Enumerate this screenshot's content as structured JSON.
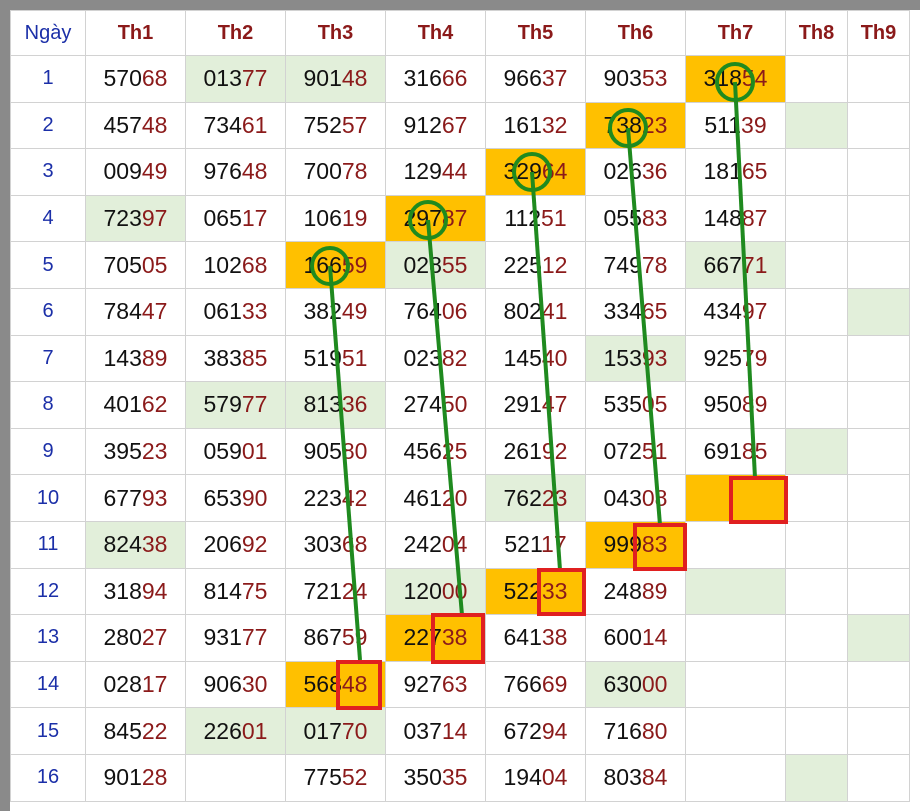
{
  "columns": [
    "Ngày",
    "Th1",
    "Th2",
    "Th3",
    "Th4",
    "Th5",
    "Th6",
    "Th7",
    "Th8",
    "Th9"
  ],
  "rows": [
    {
      "day": "1",
      "cells": [
        [
          "570",
          "68",
          "n"
        ],
        [
          "013",
          "77",
          "g"
        ],
        [
          "901",
          "48",
          "g"
        ],
        [
          "316",
          "66",
          "n"
        ],
        [
          "966",
          "37",
          "n"
        ],
        [
          "903",
          "53",
          "n"
        ],
        [
          "318",
          "54",
          "o"
        ],
        [
          "",
          "",
          "n"
        ],
        [
          "",
          "",
          "n"
        ]
      ]
    },
    {
      "day": "2",
      "cells": [
        [
          "457",
          "48",
          "n"
        ],
        [
          "734",
          "61",
          "n"
        ],
        [
          "752",
          "57",
          "n"
        ],
        [
          "912",
          "67",
          "n"
        ],
        [
          "161",
          "32",
          "n"
        ],
        [
          "738",
          "23",
          "o"
        ],
        [
          "511",
          "39",
          "n"
        ],
        [
          "",
          "",
          "g"
        ],
        [
          "",
          "",
          "n"
        ]
      ]
    },
    {
      "day": "3",
      "cells": [
        [
          "009",
          "49",
          "n"
        ],
        [
          "976",
          "48",
          "n"
        ],
        [
          "700",
          "78",
          "n"
        ],
        [
          "129",
          "44",
          "n"
        ],
        [
          "329",
          "64",
          "o"
        ],
        [
          "026",
          "36",
          "n"
        ],
        [
          "181",
          "65",
          "n"
        ],
        [
          "",
          "",
          "n"
        ],
        [
          "",
          "",
          "n"
        ]
      ]
    },
    {
      "day": "4",
      "cells": [
        [
          "723",
          "97",
          "g"
        ],
        [
          "065",
          "17",
          "n"
        ],
        [
          "106",
          "19",
          "n"
        ],
        [
          "297",
          "87",
          "o"
        ],
        [
          "112",
          "51",
          "n"
        ],
        [
          "055",
          "83",
          "n"
        ],
        [
          "148",
          "87",
          "n"
        ],
        [
          "",
          "",
          "n"
        ],
        [
          "",
          "",
          "n"
        ]
      ]
    },
    {
      "day": "5",
      "cells": [
        [
          "705",
          "05",
          "n"
        ],
        [
          "102",
          "68",
          "n"
        ],
        [
          "166",
          "59",
          "o"
        ],
        [
          "028",
          "55",
          "g"
        ],
        [
          "225",
          "12",
          "n"
        ],
        [
          "749",
          "78",
          "n"
        ],
        [
          "667",
          "71",
          "g"
        ],
        [
          "",
          "",
          "n"
        ],
        [
          "",
          "",
          "n"
        ]
      ]
    },
    {
      "day": "6",
      "cells": [
        [
          "784",
          "47",
          "n"
        ],
        [
          "061",
          "33",
          "n"
        ],
        [
          "382",
          "49",
          "n"
        ],
        [
          "764",
          "06",
          "n"
        ],
        [
          "802",
          "41",
          "n"
        ],
        [
          "334",
          "65",
          "n"
        ],
        [
          "434",
          "97",
          "n"
        ],
        [
          "",
          "",
          "n"
        ],
        [
          "",
          "",
          "g"
        ]
      ]
    },
    {
      "day": "7",
      "cells": [
        [
          "143",
          "89",
          "n"
        ],
        [
          "383",
          "85",
          "n"
        ],
        [
          "519",
          "51",
          "n"
        ],
        [
          "023",
          "82",
          "n"
        ],
        [
          "145",
          "40",
          "n"
        ],
        [
          "153",
          "93",
          "g"
        ],
        [
          "925",
          "79",
          "n"
        ],
        [
          "",
          "",
          "n"
        ],
        [
          "",
          "",
          "n"
        ]
      ]
    },
    {
      "day": "8",
      "cells": [
        [
          "401",
          "62",
          "n"
        ],
        [
          "579",
          "77",
          "g"
        ],
        [
          "813",
          "36",
          "g"
        ],
        [
          "274",
          "50",
          "n"
        ],
        [
          "291",
          "47",
          "n"
        ],
        [
          "535",
          "05",
          "n"
        ],
        [
          "950",
          "89",
          "n"
        ],
        [
          "",
          "",
          "n"
        ],
        [
          "",
          "",
          "n"
        ]
      ]
    },
    {
      "day": "9",
      "cells": [
        [
          "395",
          "23",
          "n"
        ],
        [
          "059",
          "01",
          "n"
        ],
        [
          "905",
          "80",
          "n"
        ],
        [
          "456",
          "25",
          "n"
        ],
        [
          "261",
          "92",
          "n"
        ],
        [
          "072",
          "51",
          "n"
        ],
        [
          "691",
          "85",
          "n"
        ],
        [
          "",
          "",
          "g"
        ],
        [
          "",
          "",
          "n"
        ]
      ]
    },
    {
      "day": "10",
      "cells": [
        [
          "677",
          "93",
          "n"
        ],
        [
          "653",
          "90",
          "n"
        ],
        [
          "223",
          "42",
          "n"
        ],
        [
          "461",
          "20",
          "n"
        ],
        [
          "762",
          "23",
          "g"
        ],
        [
          "043",
          "08",
          "n"
        ],
        [
          "",
          "",
          "o"
        ],
        [
          "",
          "",
          "n"
        ],
        [
          "",
          "",
          "n"
        ]
      ]
    },
    {
      "day": "11",
      "cells": [
        [
          "824",
          "38",
          "g"
        ],
        [
          "206",
          "92",
          "n"
        ],
        [
          "303",
          "68",
          "n"
        ],
        [
          "242",
          "04",
          "n"
        ],
        [
          "521",
          "17",
          "n"
        ],
        [
          "999",
          "83",
          "o"
        ],
        [
          "",
          "",
          "n"
        ],
        [
          "",
          "",
          "n"
        ],
        [
          "",
          "",
          "n"
        ]
      ]
    },
    {
      "day": "12",
      "cells": [
        [
          "318",
          "94",
          "n"
        ],
        [
          "814",
          "75",
          "n"
        ],
        [
          "721",
          "24",
          "n"
        ],
        [
          "120",
          "00",
          "g"
        ],
        [
          "522",
          "33",
          "o"
        ],
        [
          "248",
          "89",
          "n"
        ],
        [
          "",
          "",
          "g"
        ],
        [
          "",
          "",
          "n"
        ],
        [
          "",
          "",
          "n"
        ]
      ]
    },
    {
      "day": "13",
      "cells": [
        [
          "280",
          "27",
          "n"
        ],
        [
          "931",
          "77",
          "n"
        ],
        [
          "867",
          "59",
          "n"
        ],
        [
          "227",
          "38",
          "o"
        ],
        [
          "641",
          "38",
          "n"
        ],
        [
          "600",
          "14",
          "n"
        ],
        [
          "",
          "",
          "n"
        ],
        [
          "",
          "",
          "n"
        ],
        [
          "",
          "",
          "g"
        ]
      ]
    },
    {
      "day": "14",
      "cells": [
        [
          "028",
          "17",
          "n"
        ],
        [
          "906",
          "30",
          "n"
        ],
        [
          "568",
          "48",
          "o"
        ],
        [
          "927",
          "63",
          "n"
        ],
        [
          "766",
          "69",
          "n"
        ],
        [
          "630",
          "00",
          "g"
        ],
        [
          "",
          "",
          "n"
        ],
        [
          "",
          "",
          "n"
        ],
        [
          "",
          "",
          "n"
        ]
      ]
    },
    {
      "day": "15",
      "cells": [
        [
          "845",
          "22",
          "n"
        ],
        [
          "226",
          "01",
          "g"
        ],
        [
          "017",
          "70",
          "g"
        ],
        [
          "037",
          "14",
          "n"
        ],
        [
          "672",
          "94",
          "n"
        ],
        [
          "716",
          "80",
          "n"
        ],
        [
          "",
          "",
          "n"
        ],
        [
          "",
          "",
          "n"
        ],
        [
          "",
          "",
          "n"
        ]
      ]
    },
    {
      "day": "16",
      "cells": [
        [
          "901",
          "28",
          "n"
        ],
        [
          "",
          "",
          "n"
        ],
        [
          "775",
          "52",
          "n"
        ],
        [
          "350",
          "35",
          "n"
        ],
        [
          "194",
          "04",
          "n"
        ],
        [
          "803",
          "84",
          "n"
        ],
        [
          "",
          "",
          "n"
        ],
        [
          "",
          "",
          "g"
        ],
        [
          "",
          "",
          "n"
        ]
      ]
    }
  ],
  "colors": {
    "header_text": "#8b1a1a",
    "day_text": "#1b2fa8",
    "tail_text": "#8b1a1a",
    "highlight_orange": "#ffc000",
    "highlight_green": "#e2efda",
    "line_green": "#1f8a1f",
    "box_red": "#e02020"
  }
}
